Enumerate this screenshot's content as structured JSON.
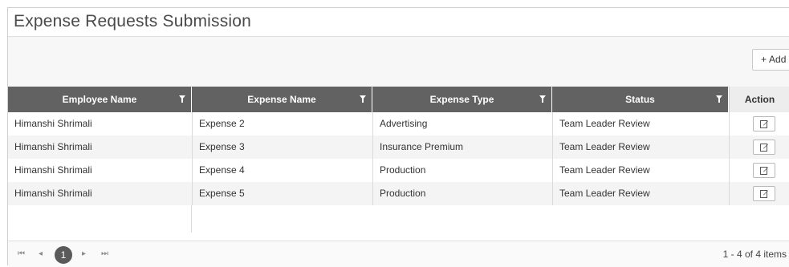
{
  "page": {
    "title": "Expense Requests Submission"
  },
  "toolbar": {
    "add_label": "Add",
    "add_icon": "+"
  },
  "table": {
    "columns": [
      "Employee Name",
      "Expense Name",
      "Expense Type",
      "Status",
      "Action"
    ],
    "rows": [
      {
        "employee": "Himanshi Shrimali",
        "expense": "Expense 2",
        "type": "Advertising",
        "status": "Team Leader Review"
      },
      {
        "employee": "Himanshi Shrimali",
        "expense": "Expense 3",
        "type": "Insurance Premium",
        "status": "Team Leader Review"
      },
      {
        "employee": "Himanshi Shrimali",
        "expense": "Expense 4",
        "type": "Production",
        "status": "Team Leader Review"
      },
      {
        "employee": "Himanshi Shrimali",
        "expense": "Expense 5",
        "type": "Production",
        "status": "Team Leader Review"
      }
    ]
  },
  "pager": {
    "first": "⏮",
    "prev": "◂",
    "current": "1",
    "next": "▸",
    "last": "⏭",
    "summary": "1 - 4 of 4 items"
  },
  "icons": {
    "filter": "filter-icon",
    "edit": "edit-icon"
  },
  "colors": {
    "header_bg": "#626262",
    "header_text": "#ffffff",
    "current_page": "#5a5a5a"
  }
}
